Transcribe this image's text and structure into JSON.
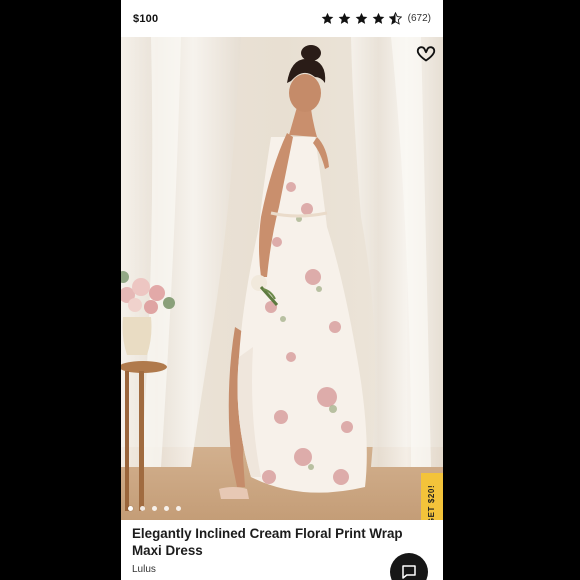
{
  "listing": {
    "price": "$100",
    "rating": 4.5,
    "rating_count": "(672)",
    "title": "Elegantly Inclined Cream Floral Print Wrap Maxi Dress",
    "brand": "Lulus"
  },
  "gallery": {
    "dot_count": 5,
    "active_index": 0
  },
  "promo": {
    "label": "GET $20!"
  },
  "icons": {
    "like": "heart-outline-icon",
    "chat": "chat-bubble-icon",
    "star": "star-icon"
  },
  "colors": {
    "promo_bg": "#f3c33a",
    "chat_bg": "#161616",
    "star": "#111111"
  }
}
